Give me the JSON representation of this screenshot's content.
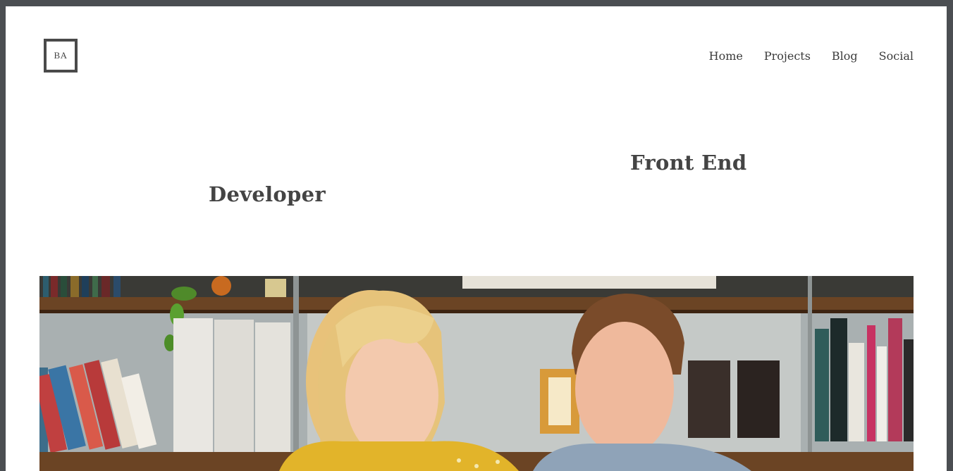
{
  "logo": {
    "text": "BA"
  },
  "nav": {
    "items": [
      {
        "label": "Home"
      },
      {
        "label": "Projects"
      },
      {
        "label": "Blog"
      },
      {
        "label": "Social"
      }
    ]
  },
  "hero": {
    "line1": "Front End",
    "line2": "Developer"
  },
  "colors": {
    "frame": "#4b4e52",
    "text": "#444444",
    "background": "#ffffff"
  }
}
